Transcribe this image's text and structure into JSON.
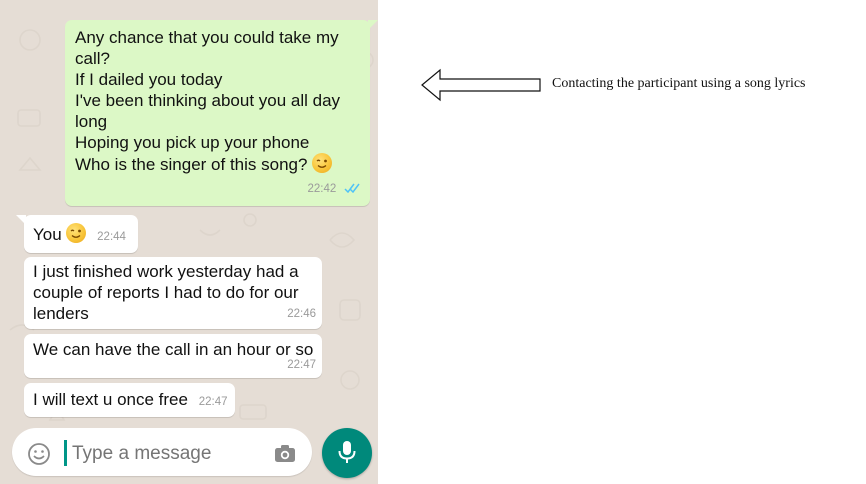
{
  "messages": [
    {
      "dir": "out",
      "lines": "Any chance that you could take my\ncall?\nIf I dailed you today\nI've been thinking about you all day\nlong\nHoping you pick up your phone\nWho is the singer of this song?",
      "emoji": "winking-face",
      "time": "22:42",
      "status": "read"
    },
    {
      "dir": "in",
      "lines": "You",
      "emoji": "winking-face",
      "time": "22:44"
    },
    {
      "dir": "in",
      "lines": "I just finished work yesterday had a\ncouple of reports I had to do for our\nlenders",
      "time": "22:46"
    },
    {
      "dir": "in",
      "lines": "We can have the call in an hour or so",
      "time": "22:47"
    },
    {
      "dir": "in",
      "lines": "I will text u once free",
      "time": "22:47"
    }
  ],
  "input": {
    "placeholder": "Type a message",
    "emoji_icon": "smiley-icon",
    "camera_icon": "camera-icon",
    "send_icon": "microphone-icon"
  },
  "annotation": {
    "text": "Contacting the participant using a song lyrics"
  },
  "colors": {
    "outgoing_bubble": "#dcf8c6",
    "incoming_bubble": "#ffffff",
    "chat_background": "#e5ddd5",
    "accent": "#00897b",
    "read_ticks": "#4fc3f7"
  }
}
